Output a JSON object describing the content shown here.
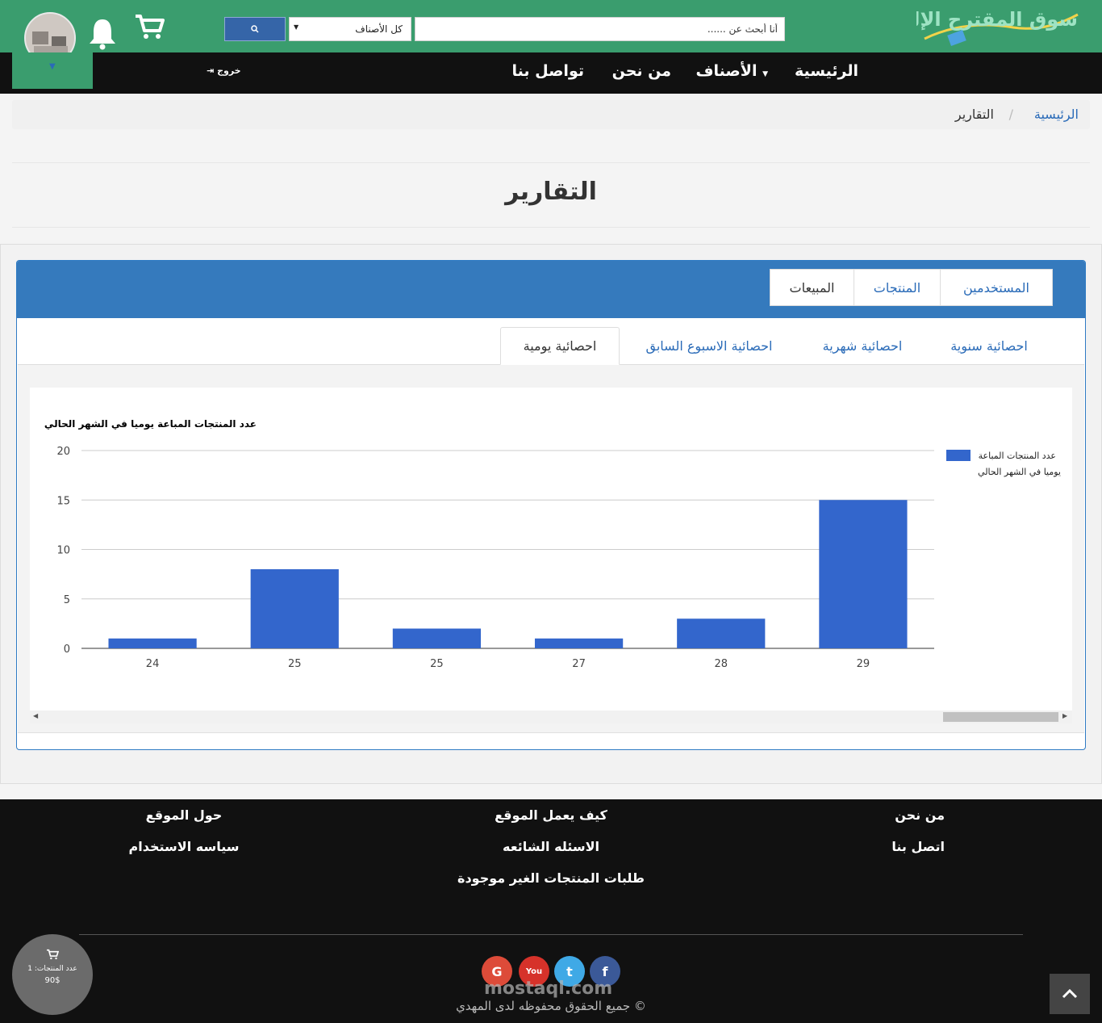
{
  "header": {
    "logo_text": "سوق المقترح الإلكتروني",
    "search_placeholder": "أنا أبحث عن ......",
    "category_select": "كل الأصناف",
    "colors": {
      "brand_green": "#3a9d6e",
      "nav_black": "#111111",
      "accent_blue": "#357abd",
      "bar_blue": "#3366cc"
    }
  },
  "nav": {
    "home": "الرئيسية",
    "categories": "الأصناف",
    "about": "من نحن",
    "contact": "تواصل بنا",
    "logout": "خروج"
  },
  "breadcrumb": {
    "home": "الرئيسية",
    "separator": "/",
    "current": "التقارير"
  },
  "page_title": "التقارير",
  "tabs": {
    "users": "المستخدمين",
    "products": "المنتجات",
    "sales": "المبيعات"
  },
  "subtabs": {
    "yearly": "احصائية سنوية",
    "monthly": "احصائية شهرية",
    "last_week": "احصائية الاسبوع السابق",
    "daily": "احصائية يومية"
  },
  "chart_data": {
    "type": "bar",
    "title": "عدد المنتجات المباعة يوميا في الشهر الحالي",
    "categories": [
      "24",
      "25",
      "25",
      "27",
      "28",
      "29"
    ],
    "values": [
      1,
      8,
      2,
      1,
      3,
      15
    ],
    "ylim": [
      0,
      20
    ],
    "yticks": [
      "0",
      "5",
      "10",
      "15",
      "20"
    ],
    "legend": {
      "line1": "عدد المنتجات المباعة",
      "line2": "يوميا في الشهر الحالي",
      "placement": "right"
    },
    "color": "#3366cc",
    "grid": true
  },
  "footer": {
    "col1": {
      "about": "من نحن",
      "contact": "اتصل بنا"
    },
    "col2": {
      "how": "كيف يعمل الموقع",
      "faq": "الاسئله الشائعه",
      "requests": "طلبات المنتجات الغير موجودة"
    },
    "col3": {
      "about_site": "حول الموقع",
      "policy": "سياسه الاستخدام"
    },
    "copyright": "جميع الحقوق محفوظه لدى المهدي ©",
    "watermark": "mostaql.com",
    "social": {
      "google": "G",
      "youtube": "You",
      "twitter": "t",
      "facebook": "f"
    }
  },
  "cart_summary": {
    "label": "عدد المنتجات: 1",
    "total": "90$"
  }
}
